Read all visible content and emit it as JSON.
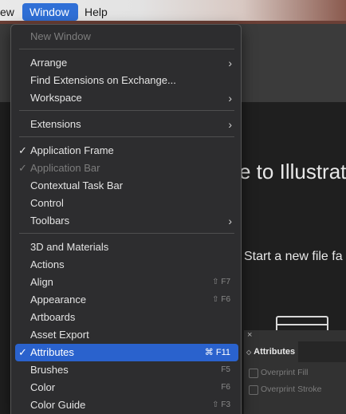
{
  "menubar": {
    "view_label": "ew",
    "window_label": "Window",
    "help_label": "Help"
  },
  "background": {
    "welcome_text": "e to Illustrato",
    "start_new_text": "Start a new file fa",
    "panel": {
      "close": "×",
      "tab_label": "Attributes",
      "options": [
        "Overprint Fill",
        "Overprint Stroke"
      ]
    }
  },
  "window_menu": {
    "items": [
      {
        "label": "New Window",
        "disabled": true
      },
      {
        "label": "Arrange",
        "submenu": true
      },
      {
        "label": "Find Extensions on Exchange..."
      },
      {
        "label": "Workspace",
        "submenu": true
      },
      {
        "label": "Extensions",
        "submenu": true
      },
      {
        "label": "Application Frame",
        "checked": true
      },
      {
        "label": "Application Bar",
        "checked": true,
        "disabled": true
      },
      {
        "label": "Contextual Task Bar"
      },
      {
        "label": "Control"
      },
      {
        "label": "Toolbars",
        "submenu": true
      },
      {
        "label": "3D and Materials"
      },
      {
        "label": "Actions"
      },
      {
        "label": "Align",
        "shortcut": "⇧ F7"
      },
      {
        "label": "Appearance",
        "shortcut": "⇧ F6"
      },
      {
        "label": "Artboards"
      },
      {
        "label": "Asset Export"
      },
      {
        "label": "Attributes",
        "checked": true,
        "selected": true,
        "shortcut": "⌘ F11"
      },
      {
        "label": "Brushes",
        "shortcut": "F5"
      },
      {
        "label": "Color",
        "shortcut": "F6"
      },
      {
        "label": "Color Guide",
        "shortcut": "⇧ F3"
      }
    ]
  },
  "colors": {
    "highlight": "#2a62cd",
    "menu_bg": "#2d2d2f"
  }
}
